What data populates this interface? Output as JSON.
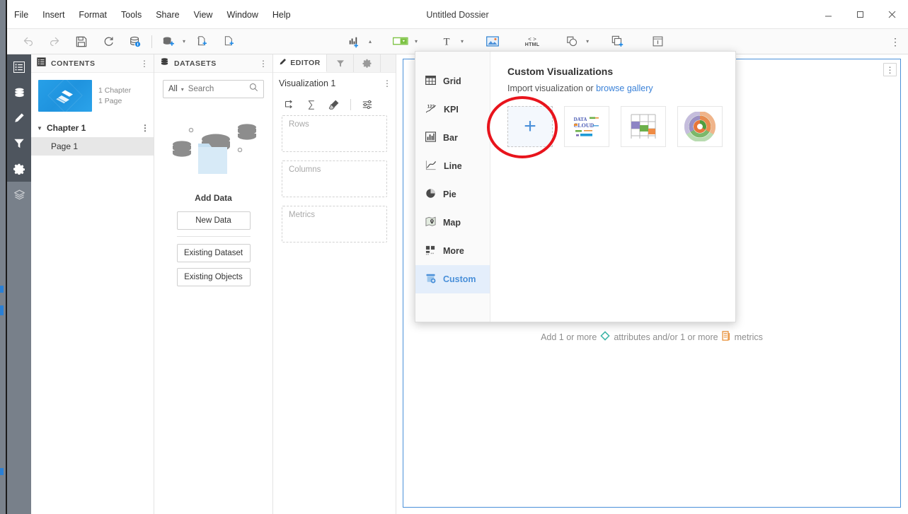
{
  "window": {
    "title": "Untitled Dossier",
    "minimize_label": "–",
    "maximize_label": "□",
    "close_label": "✕"
  },
  "menubar": {
    "items": [
      {
        "label": "File"
      },
      {
        "label": "Insert"
      },
      {
        "label": "Format"
      },
      {
        "label": "Tools"
      },
      {
        "label": "Share"
      },
      {
        "label": "View"
      },
      {
        "label": "Window"
      },
      {
        "label": "Help"
      }
    ]
  },
  "toolbar": {
    "items": [
      {
        "name": "undo-icon",
        "tooltip": "Undo"
      },
      {
        "name": "redo-icon",
        "tooltip": "Redo"
      },
      {
        "name": "save-icon",
        "tooltip": "Save"
      },
      {
        "name": "refresh-icon",
        "tooltip": "Refresh"
      },
      {
        "name": "data-info-icon",
        "tooltip": "Dataset information"
      },
      {
        "name": "add-data-icon",
        "tooltip": "Add data"
      },
      {
        "name": "insert-visualization-icon",
        "tooltip": "Insert visualization"
      },
      {
        "name": "insert-page-icon",
        "tooltip": "Insert page"
      },
      {
        "name": "insert-chart-icon",
        "tooltip": "Insert chart"
      },
      {
        "name": "insert-selector-icon",
        "tooltip": "Insert selector"
      },
      {
        "name": "insert-text-icon",
        "tooltip": "Insert text"
      },
      {
        "name": "insert-image-icon",
        "tooltip": "Insert image"
      },
      {
        "name": "insert-html-icon",
        "tooltip": "Insert HTML container"
      },
      {
        "name": "insert-shape-icon",
        "tooltip": "Insert shape"
      },
      {
        "name": "insert-panel-stack-icon",
        "tooltip": "Insert panel stack"
      },
      {
        "name": "insert-info-window-icon",
        "tooltip": "Insert information window"
      }
    ],
    "html_label": "HTML",
    "overflow_label": "⋮"
  },
  "rail": {
    "items": [
      {
        "name": "sidebar-item-contents",
        "label": "Table of Contents",
        "active": true
      },
      {
        "name": "sidebar-item-datasets",
        "label": "Datasets",
        "active": true
      },
      {
        "name": "sidebar-item-editor",
        "label": "Editor",
        "active": true
      },
      {
        "name": "sidebar-item-filters",
        "label": "Filters",
        "active": true
      },
      {
        "name": "sidebar-item-settings",
        "label": "Settings",
        "active": true
      },
      {
        "name": "sidebar-item-layers",
        "label": "Layers",
        "active": false
      }
    ]
  },
  "contents": {
    "header": "CONTENTS",
    "kebab": "⋮",
    "thumbnail_meta_line1": "1 Chapter",
    "thumbnail_meta_line2": "1 Page",
    "chapter_label": "Chapter 1",
    "chapter_caret": "▼",
    "chapter_kebab": "⋮",
    "page_label": "Page 1"
  },
  "datasets": {
    "header": "DATASETS",
    "kebab": "⋮",
    "filter_value": "All",
    "filter_caret": "∨",
    "search_placeholder": "Search",
    "add_data_title": "Add Data",
    "buttons": [
      {
        "label": "New Data"
      },
      {
        "label": "Existing Dataset"
      },
      {
        "label": "Existing Objects"
      }
    ]
  },
  "editor": {
    "tabs": [
      {
        "label": "EDITOR",
        "name": "tab-editor"
      },
      {
        "label": "",
        "name": "tab-filters"
      },
      {
        "label": "",
        "name": "tab-properties"
      }
    ],
    "viz_title": "Visualization 1",
    "viz_kebab": "⋮",
    "tools": [
      {
        "name": "swap-rows-columns-icon"
      },
      {
        "name": "sum-totals-icon"
      },
      {
        "name": "clear-all-icon"
      },
      {
        "name": "editor-settings-icon"
      }
    ],
    "dropzones": [
      {
        "label": "Rows",
        "name": "dropzone-rows"
      },
      {
        "label": "Columns",
        "name": "dropzone-columns"
      },
      {
        "label": "Metrics",
        "name": "dropzone-metrics"
      }
    ]
  },
  "canvas": {
    "viz_kebab": "⋮",
    "hint_part1": "Add 1 or more",
    "hint_attributes": "attributes and/or 1 or more",
    "hint_metrics": "metrics"
  },
  "popup": {
    "viz_types": [
      {
        "label": "Grid",
        "name": "viz-type-grid",
        "active": false
      },
      {
        "label": "KPI",
        "name": "viz-type-kpi",
        "active": false
      },
      {
        "label": "Bar",
        "name": "viz-type-bar",
        "active": false
      },
      {
        "label": "Line",
        "name": "viz-type-line",
        "active": false
      },
      {
        "label": "Pie",
        "name": "viz-type-pie",
        "active": false
      },
      {
        "label": "Map",
        "name": "viz-type-map",
        "active": false
      },
      {
        "label": "More",
        "name": "viz-type-more",
        "active": false
      },
      {
        "label": "Custom",
        "name": "viz-type-custom",
        "active": true
      }
    ],
    "title": "Custom Visualizations",
    "subtitle_prefix": "Import visualization or",
    "gallery_link": "browse gallery",
    "import_tile_plus": "+",
    "tiles": [
      {
        "name": "import-visualization-tile",
        "label": ""
      },
      {
        "name": "data-cloud-visualization-tile",
        "label": "DATA CLOUD"
      },
      {
        "name": "grid-heatmap-visualization-tile",
        "label": ""
      },
      {
        "name": "sunburst-visualization-tile",
        "label": ""
      }
    ]
  },
  "annotation": {
    "shape": "ellipse",
    "color": "#e8141c",
    "target": "import-visualization-tile"
  },
  "colors": {
    "accent_blue": "#4a90d9",
    "link_blue": "#3b82d8",
    "rail_bg": "#78808a",
    "rail_active": "#4e555e",
    "annotation_red": "#e8141c",
    "attribute_teal": "#3fb6a8",
    "metric_orange": "#e8913a"
  }
}
